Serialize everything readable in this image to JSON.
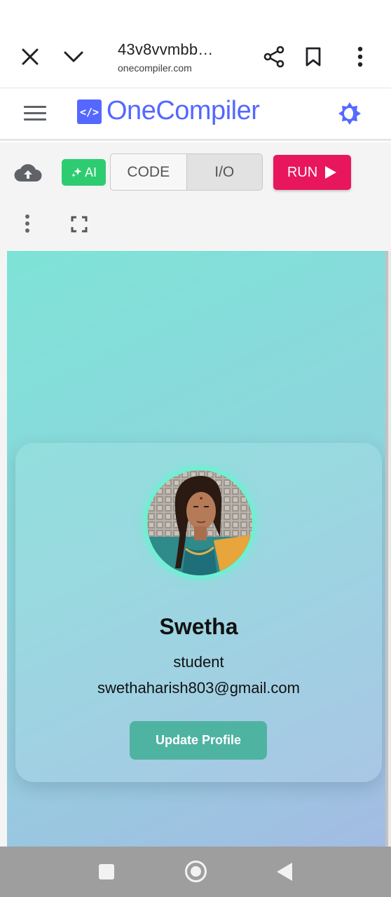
{
  "browser": {
    "page_title": "43v8vvmbb…",
    "url": "onecompiler.com"
  },
  "site": {
    "logo_mark": "</>",
    "logo_text": "OneCompiler"
  },
  "toolbar": {
    "ai_label": "AI",
    "tabs": [
      {
        "label": "CODE",
        "active": false
      },
      {
        "label": "I/O",
        "active": true
      }
    ],
    "run_label": "RUN"
  },
  "profile": {
    "name": "Swetha",
    "role": "student",
    "email": "swethaharish803@gmail.com",
    "button_label": "Update Profile"
  },
  "colors": {
    "brand": "#5468ff",
    "run": "#e8175d",
    "ai": "#2ecc71",
    "card_button": "#4fb3a2",
    "avatar_ring": "#6ef0d3"
  }
}
